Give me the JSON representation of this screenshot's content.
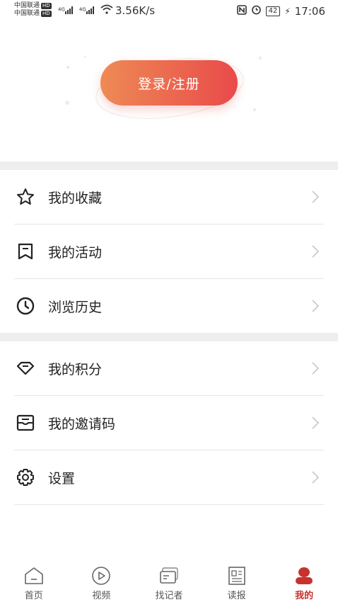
{
  "status_bar": {
    "carrier1": "中国联通",
    "carrier2": "中国联通",
    "hd_badge": "HD",
    "net1": "4G",
    "net2": "4G",
    "speed": "3.56K/s",
    "battery": "42",
    "time": "17:06"
  },
  "login": {
    "label": "登录/注册"
  },
  "menu_group1": [
    {
      "label": "我的收藏",
      "icon": "star-icon"
    },
    {
      "label": "我的活动",
      "icon": "bookmark-icon"
    },
    {
      "label": "浏览历史",
      "icon": "clock-icon"
    }
  ],
  "menu_group2": [
    {
      "label": "我的积分",
      "icon": "diamond-icon"
    },
    {
      "label": "我的邀请码",
      "icon": "inbox-icon"
    },
    {
      "label": "设置",
      "icon": "gear-icon"
    }
  ],
  "tabs": [
    {
      "label": "首页",
      "icon": "home-icon"
    },
    {
      "label": "视频",
      "icon": "play-icon"
    },
    {
      "label": "找记者",
      "icon": "card-icon"
    },
    {
      "label": "读报",
      "icon": "newspaper-icon"
    },
    {
      "label": "我的",
      "icon": "user-icon",
      "active": true
    }
  ],
  "colors": {
    "accent": "#c8322e",
    "gradient_start": "#ee8a55",
    "gradient_end": "#e94a4a",
    "band": "#eeeeee"
  }
}
